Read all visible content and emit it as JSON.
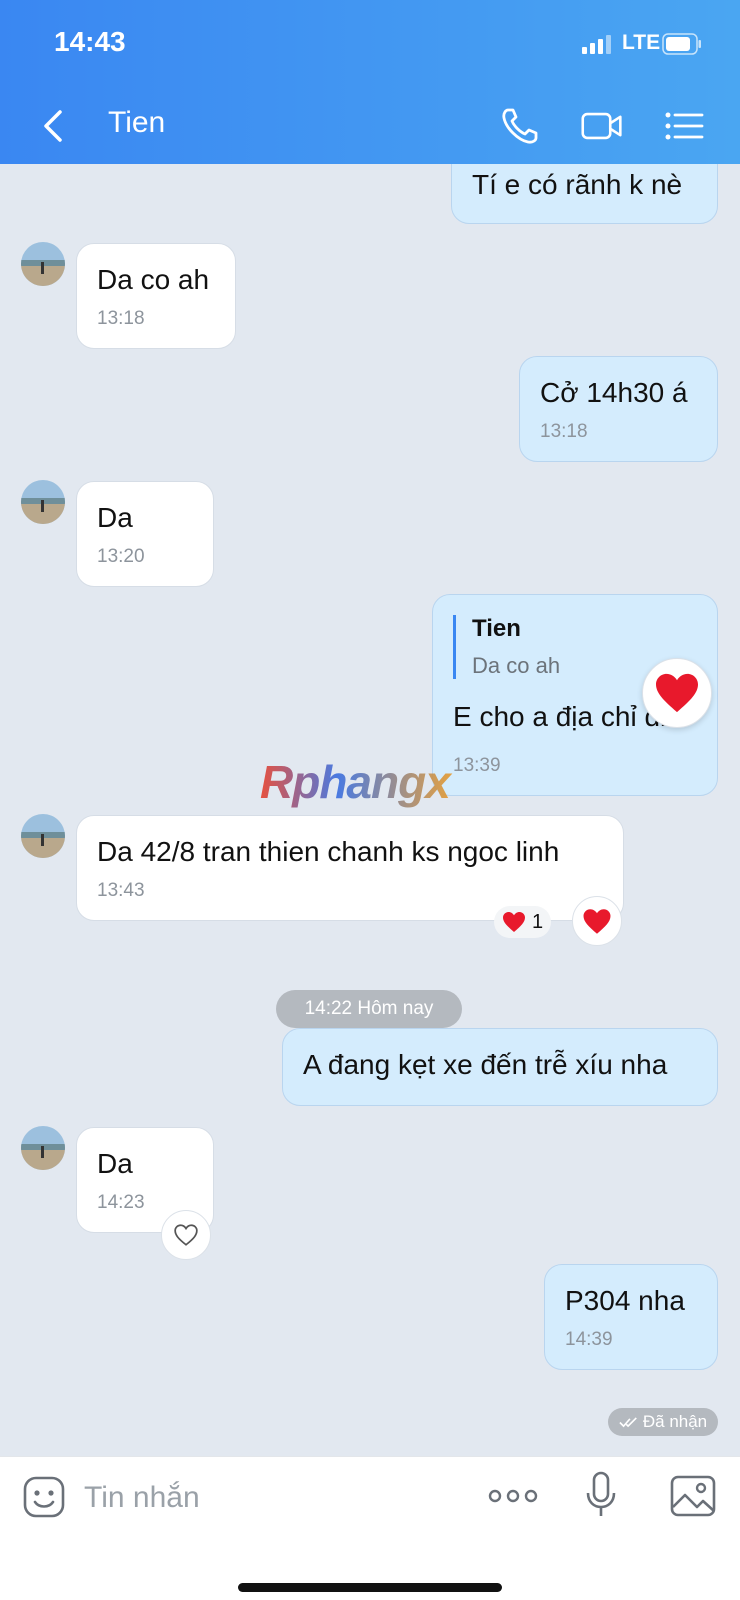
{
  "status": {
    "time": "14:43",
    "network": "LTE"
  },
  "header": {
    "title": "Tien"
  },
  "messages": [
    {
      "text": "Tí e có rãnh k nè"
    },
    {
      "text": "Da co ah",
      "time": "13:18"
    },
    {
      "text": "Cở 14h30 á",
      "time": "13:18"
    },
    {
      "text": "Da",
      "time": "13:20"
    },
    {
      "reply_name": "Tien",
      "reply_text": "Da co ah",
      "text": "E cho a địa chỉ đi",
      "time": "13:39"
    },
    {
      "text": "Da 42/8 tran thien chanh ks ngoc linh",
      "time": "13:43",
      "reaction_count": "1"
    },
    {
      "text": "A đang kẹt xe đến trễ xíu nha"
    },
    {
      "text": "Da",
      "time": "14:23"
    },
    {
      "text": "P304 nha",
      "time": "14:39"
    }
  ],
  "date_divider": "14:22 Hôm nay",
  "delivery_status": "Đã nhận",
  "watermark": "Rphangx",
  "input": {
    "placeholder": "Tin nhắn"
  },
  "colors": {
    "header_start": "#3a87f2",
    "header_end": "#4aa6f2",
    "outgoing_bubble": "#d4ecfd",
    "incoming_bubble": "#ffffff",
    "chat_bg": "#e2e8f0",
    "heart": "#e8192c"
  }
}
